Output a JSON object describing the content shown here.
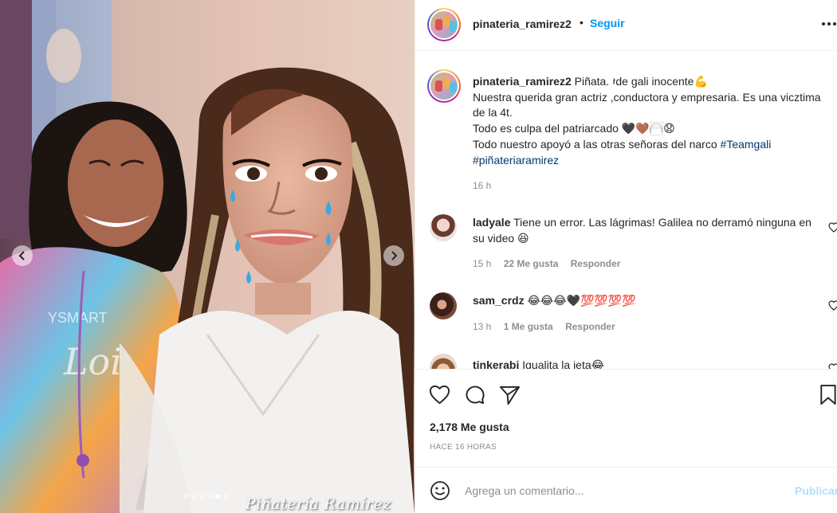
{
  "media": {
    "watermark": "Piñatería Ramírez",
    "carousel": {
      "count": 6,
      "active_index": 4
    }
  },
  "post": {
    "username": "pinateria_ramirez2",
    "separator": "•",
    "follow_label": "Seguir",
    "more_icon": "more-horizontal-icon",
    "caption": {
      "username": "pinateria_ramirez2",
      "line1": "Piñata. 𝄽de gali inocente💪",
      "line2": "Nuestra querida gran actriz ,conductora y empresaria. Es una vicztima de la 4t.",
      "line3": "Todo es culpa del patriarcado 🖤🤎🦳😧",
      "line4_text": "Todo nuestro apoyó a las otras señoras del narco",
      "hashtag1": "#Teamgali",
      "hashtag2": "#piñateriaramirez",
      "time": "16 h"
    },
    "comments": [
      {
        "username": "ladyale",
        "text": "Tiene un error. Las lágrimas! Galilea no derramó ninguna en su video 😆",
        "time": "15 h",
        "likes": "22 Me gusta",
        "reply": "Responder"
      },
      {
        "username": "sam_crdz",
        "text": "😂😂😂🖤💯💯💯💯",
        "time": "13 h",
        "likes": "1 Me gusta",
        "reply": "Responder"
      },
      {
        "username": "tinkerabi",
        "text": "Igualita la jeta😂"
      }
    ],
    "likes_count": "2,178 Me gusta",
    "age": "HACE 16 HORAS",
    "add_comment": {
      "placeholder": "Agrega un comentario...",
      "publish_label": "Publicar"
    }
  },
  "colors": {
    "link": "#0095f6",
    "hashtag": "#00376b",
    "muted": "#8e8e8e",
    "border": "#efefef",
    "publish_disabled": "#b2dffc"
  }
}
